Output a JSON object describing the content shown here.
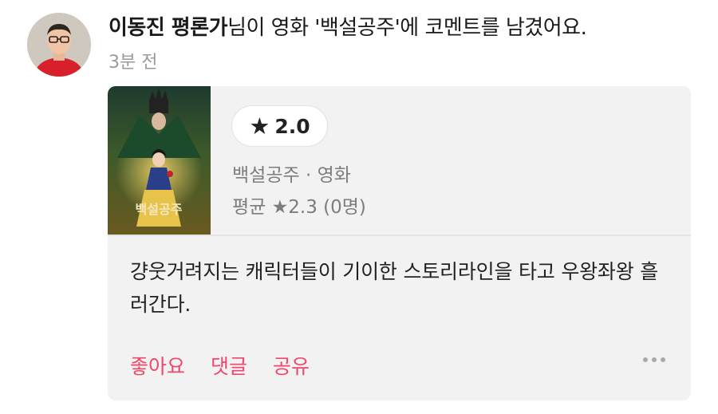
{
  "activity": {
    "user_name": "이동진 평론가",
    "action_text": "님이 영화 '백설공주'에 코멘트를 남겼어요.",
    "time_ago": "3분 전"
  },
  "card": {
    "poster_title": "백설공주",
    "my_rating_star": "★",
    "my_rating": "2.0",
    "movie_meta": "백설공주 · 영화",
    "average_rating": "평균 ★2.3 (0명)",
    "comment": "걍웃거려지는 캐릭터들이 기이한 스토리라인을 타고 우왕좌왕 흘러간다.",
    "actions": {
      "like": "좋아요",
      "reply": "댓글",
      "share": "공유"
    }
  },
  "colors": {
    "accent": "#f0476a",
    "card_background": "#f2f2f2",
    "muted_text": "#7d7d7d"
  }
}
